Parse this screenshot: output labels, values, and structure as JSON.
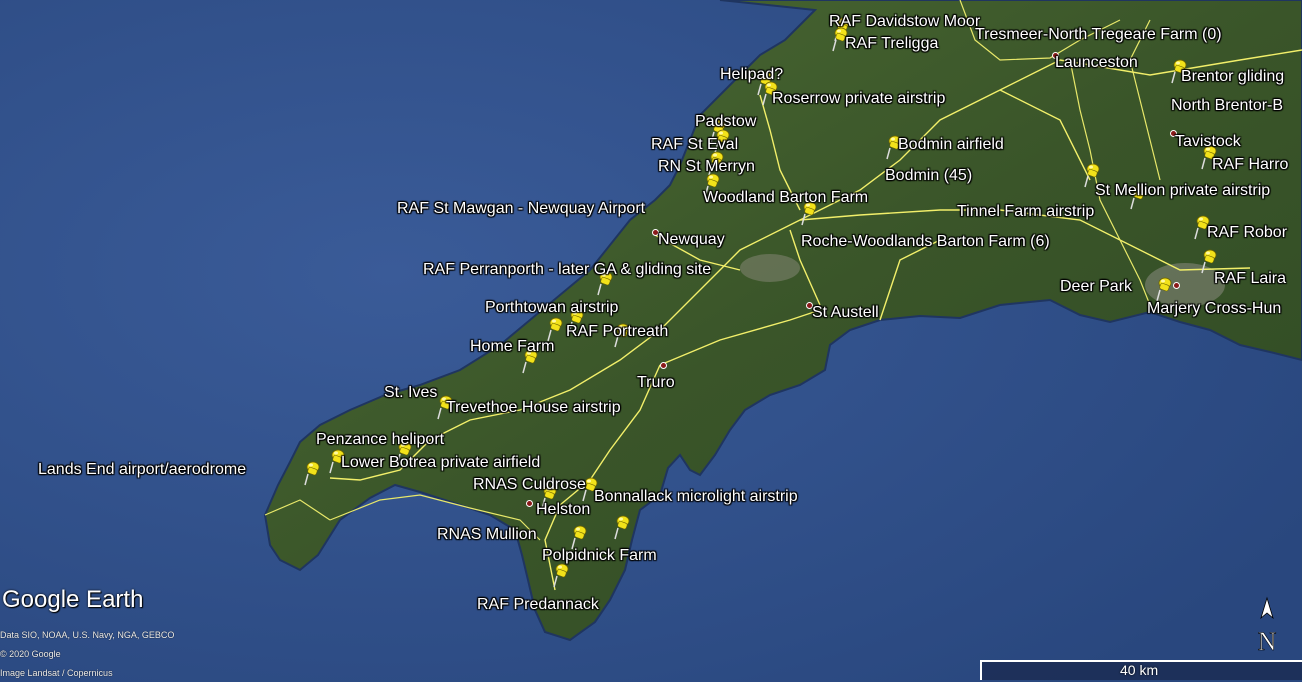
{
  "places": [
    {
      "name": "RAF Davidstow Moor",
      "kind": "pin"
    },
    {
      "name": "RAF Treligga",
      "kind": "pin"
    },
    {
      "name": "Tresmeer-North Tregeare Farm (0)",
      "kind": "label"
    },
    {
      "name": "Launceston",
      "kind": "town"
    },
    {
      "name": "Brentor gliding",
      "kind": "pin"
    },
    {
      "name": "North Brentor-B",
      "kind": "label"
    },
    {
      "name": "Tavistock",
      "kind": "town"
    },
    {
      "name": "RAF Harro",
      "kind": "pin"
    },
    {
      "name": "Helipad?",
      "kind": "pin"
    },
    {
      "name": "Roserrow private airstrip",
      "kind": "pin"
    },
    {
      "name": "Padstow",
      "kind": "label"
    },
    {
      "name": "RAF St Eval",
      "kind": "pin"
    },
    {
      "name": "RN St Merryn",
      "kind": "pin"
    },
    {
      "name": "Bodmin airfield",
      "kind": "pin"
    },
    {
      "name": "Bodmin (45)",
      "kind": "label"
    },
    {
      "name": "St Mellion private airstrip",
      "kind": "pin"
    },
    {
      "name": "Woodland Barton Farm",
      "kind": "pin"
    },
    {
      "name": "RAF St Mawgan - Newquay Airport",
      "kind": "pin"
    },
    {
      "name": "Tinnel Farm airstrip",
      "kind": "pin"
    },
    {
      "name": "RAF Robor",
      "kind": "pin"
    },
    {
      "name": "Newquay",
      "kind": "town"
    },
    {
      "name": "Roche-Woodlands Barton Farm (6)",
      "kind": "pin"
    },
    {
      "name": "RAF Perranporth - later GA & gliding site",
      "kind": "pin"
    },
    {
      "name": "RAF Laira",
      "kind": "pin"
    },
    {
      "name": "Deer Park",
      "kind": "pin"
    },
    {
      "name": "Marjery Cross-Hun",
      "kind": "label"
    },
    {
      "name": "Porthtowan airstrip",
      "kind": "pin"
    },
    {
      "name": "St Austell",
      "kind": "town"
    },
    {
      "name": "RAF Portreath",
      "kind": "pin"
    },
    {
      "name": "Home Farm",
      "kind": "pin"
    },
    {
      "name": "Truro",
      "kind": "town"
    },
    {
      "name": "St. Ives",
      "kind": "label"
    },
    {
      "name": "Trevethoe House airstrip",
      "kind": "pin"
    },
    {
      "name": "Penzance heliport",
      "kind": "pin"
    },
    {
      "name": "Lands End airport/aerodrome",
      "kind": "pin"
    },
    {
      "name": "Lower Botrea private airfield",
      "kind": "pin"
    },
    {
      "name": "RNAS Culdrose",
      "kind": "pin"
    },
    {
      "name": "Bonnallack microlight airstrip",
      "kind": "pin"
    },
    {
      "name": "Helston",
      "kind": "town"
    },
    {
      "name": "RNAS Mullion",
      "kind": "pin"
    },
    {
      "name": "Polpidnick Farm",
      "kind": "pin"
    },
    {
      "name": "RAF Predannack",
      "kind": "pin"
    }
  ],
  "brand": "Google Earth",
  "credits": [
    "Data SIO, NOAA, U.S. Navy, NGA, GEBCO",
    "© 2020 Google",
    "Image Landsat / Copernicus"
  ],
  "scale_label": "40 km",
  "north_label": "N",
  "colors": {
    "sea": "#2f4f8a",
    "land": "#3e5a2c",
    "road": "#f2ef6a",
    "pin": "#f2e21a"
  }
}
